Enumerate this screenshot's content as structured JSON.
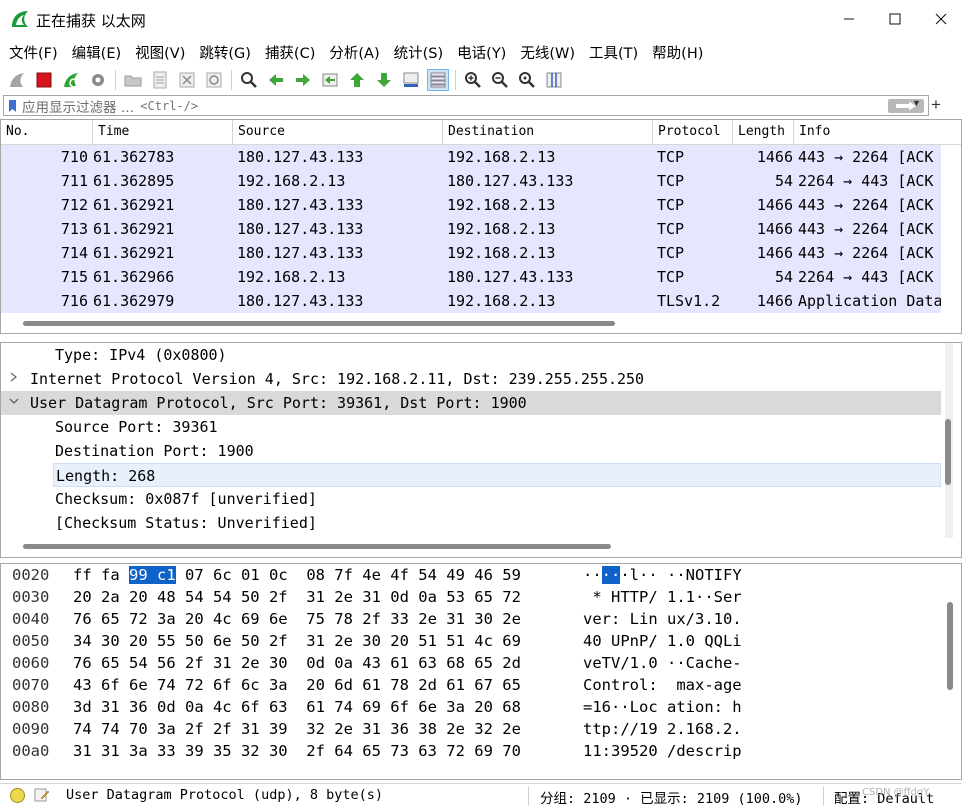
{
  "window": {
    "title": "正在捕获 以太网"
  },
  "menu": {
    "items": [
      "文件(F)",
      "编辑(E)",
      "视图(V)",
      "跳转(G)",
      "捕获(C)",
      "分析(A)",
      "统计(S)",
      "电话(Y)",
      "无线(W)",
      "工具(T)",
      "帮助(H)"
    ]
  },
  "filter": {
    "label": "应用显示过滤器 …",
    "placeholder": "<Ctrl-/>"
  },
  "packet_list": {
    "columns": [
      "No.",
      "Time",
      "Source",
      "Destination",
      "Protocol",
      "Length",
      "Info"
    ],
    "rows": [
      {
        "no": "710",
        "time": "61.362783",
        "src": "180.127.43.133",
        "dst": "192.168.2.13",
        "proto": "TCP",
        "len": "1466",
        "info": "443 → 2264 [ACK"
      },
      {
        "no": "711",
        "time": "61.362895",
        "src": "192.168.2.13",
        "dst": "180.127.43.133",
        "proto": "TCP",
        "len": "54",
        "info": "2264 → 443 [ACK"
      },
      {
        "no": "712",
        "time": "61.362921",
        "src": "180.127.43.133",
        "dst": "192.168.2.13",
        "proto": "TCP",
        "len": "1466",
        "info": "443 → 2264 [ACK"
      },
      {
        "no": "713",
        "time": "61.362921",
        "src": "180.127.43.133",
        "dst": "192.168.2.13",
        "proto": "TCP",
        "len": "1466",
        "info": "443 → 2264 [ACK"
      },
      {
        "no": "714",
        "time": "61.362921",
        "src": "180.127.43.133",
        "dst": "192.168.2.13",
        "proto": "TCP",
        "len": "1466",
        "info": "443 → 2264 [ACK"
      },
      {
        "no": "715",
        "time": "61.362966",
        "src": "192.168.2.13",
        "dst": "180.127.43.133",
        "proto": "TCP",
        "len": "54",
        "info": "2264 → 443 [ACK"
      },
      {
        "no": "716",
        "time": "61.362979",
        "src": "180.127.43.133",
        "dst": "192.168.2.13",
        "proto": "TLSv1.2",
        "len": "1466",
        "info": "Application Data"
      }
    ]
  },
  "details": {
    "rows": [
      {
        "text": "Type: IPv4 (0x0800)",
        "arrow": ""
      },
      {
        "text": "Internet Protocol Version 4, Src: 192.168.2.11, Dst: 239.255.255.250",
        "arrow": ">"
      },
      {
        "text": "User Datagram Protocol, Src Port: 39361, Dst Port: 1900",
        "arrow": "v"
      },
      {
        "text": "Source Port: 39361",
        "arrow": ""
      },
      {
        "text": "Destination Port: 1900",
        "arrow": ""
      },
      {
        "text": "Length: 268",
        "arrow": ""
      },
      {
        "text": "Checksum: 0x087f [unverified]",
        "arrow": ""
      },
      {
        "text": "[Checksum Status: Unverified]",
        "arrow": ""
      }
    ]
  },
  "bytes": {
    "rows": [
      {
        "offset": "0020",
        "hex_pre": "ff fa ",
        "hex_hl": "99 c1",
        "hex_post": " 07 6c 01 0c  08 7f 4e 4f 54 49 46 59",
        "ascii_pre": "··",
        "ascii_hl": "··",
        "ascii_post": "·l·· ··NOTIFY"
      },
      {
        "offset": "0030",
        "hex_pre": "20 2a 20 48 54 54 50 2f  31 2e 31 0d 0a 53 65 72",
        "hex_hl": "",
        "hex_post": "",
        "ascii_pre": " * HTTP/ 1.1··Ser",
        "ascii_hl": "",
        "ascii_post": ""
      },
      {
        "offset": "0040",
        "hex_pre": "76 65 72 3a 20 4c 69 6e  75 78 2f 33 2e 31 30 2e",
        "hex_hl": "",
        "hex_post": "",
        "ascii_pre": "ver: Lin ux/3.10.",
        "ascii_hl": "",
        "ascii_post": ""
      },
      {
        "offset": "0050",
        "hex_pre": "34 30 20 55 50 6e 50 2f  31 2e 30 20 51 51 4c 69",
        "hex_hl": "",
        "hex_post": "",
        "ascii_pre": "40 UPnP/ 1.0 QQLi",
        "ascii_hl": "",
        "ascii_post": ""
      },
      {
        "offset": "0060",
        "hex_pre": "76 65 54 56 2f 31 2e 30  0d 0a 43 61 63 68 65 2d",
        "hex_hl": "",
        "hex_post": "",
        "ascii_pre": "veTV/1.0 ··Cache-",
        "ascii_hl": "",
        "ascii_post": ""
      },
      {
        "offset": "0070",
        "hex_pre": "43 6f 6e 74 72 6f 6c 3a  20 6d 61 78 2d 61 67 65",
        "hex_hl": "",
        "hex_post": "",
        "ascii_pre": "Control:  max-age",
        "ascii_hl": "",
        "ascii_post": ""
      },
      {
        "offset": "0080",
        "hex_pre": "3d 31 36 0d 0a 4c 6f 63  61 74 69 6f 6e 3a 20 68",
        "hex_hl": "",
        "hex_post": "",
        "ascii_pre": "=16··Loc ation: h",
        "ascii_hl": "",
        "ascii_post": ""
      },
      {
        "offset": "0090",
        "hex_pre": "74 74 70 3a 2f 2f 31 39  32 2e 31 36 38 2e 32 2e",
        "hex_hl": "",
        "hex_post": "",
        "ascii_pre": "ttp://19 2.168.2.",
        "ascii_hl": "",
        "ascii_post": ""
      },
      {
        "offset": "00a0",
        "hex_pre": "31 31 3a 33 39 35 32 30  2f 64 65 73 63 72 69 70",
        "hex_hl": "",
        "hex_post": "",
        "ascii_pre": "11:39520 /descrip",
        "ascii_hl": "",
        "ascii_post": ""
      }
    ]
  },
  "status": {
    "field": "User Datagram Protocol (udp), 8 byte(s)",
    "packets": "分组: 2109 · 已显示: 2109 (100.0%)",
    "profile": "配置: Default",
    "watermark": "CSDN @ffdgY"
  },
  "colors": {
    "row_bg": "#e7e6ff",
    "selection": "#0f62c9",
    "led": "#ecd94b"
  }
}
